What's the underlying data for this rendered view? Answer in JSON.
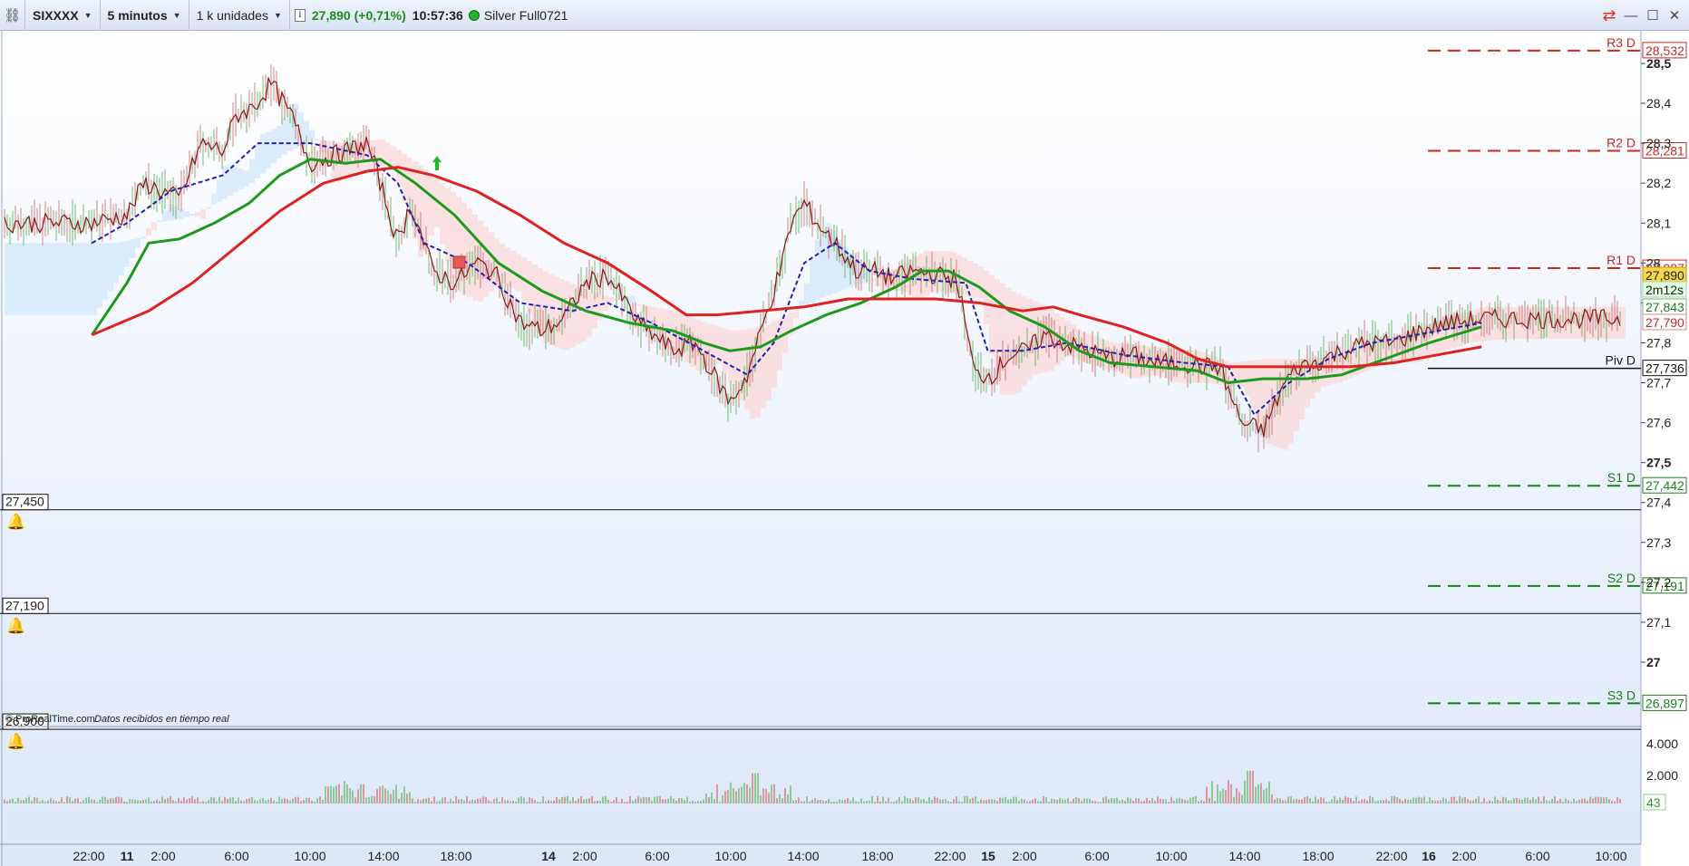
{
  "toolbar": {
    "symbol": "SIXXXX",
    "timeframe": "5 minutos",
    "units": "1 k unidades",
    "info_icon": "i",
    "quote": "27,890 (+0,71%)",
    "time": "10:57:36",
    "source": "Silver Full0721",
    "link_icon": "chain-link-icon",
    "status_color": "#22b22c"
  },
  "colors": {
    "sma_green": "#1d9a1d",
    "sma_red": "#dd2222",
    "price": "#8b1a1a",
    "kijun": "#1f22b0",
    "resistance": "#c62828",
    "support": "#1b7f1b"
  },
  "y_axis": {
    "ticks": [
      "28,5",
      "28,4",
      "28,3",
      "28,2",
      "28,1",
      "28",
      "27,9",
      "27,8",
      "27,7",
      "27,6",
      "27,5",
      "27,4",
      "27,3",
      "27,2",
      "27,1",
      "27"
    ],
    "bold_ticks": [
      "28,5",
      "27,5",
      "27"
    ]
  },
  "pivots": [
    {
      "name": "R3 D",
      "value": 28.532,
      "text": "28,532",
      "kind": "resistance"
    },
    {
      "name": "R2 D",
      "value": 28.281,
      "text": "28,281",
      "kind": "resistance"
    },
    {
      "name": "R1 D",
      "value": 27.987,
      "text": "27,987",
      "kind": "resistance"
    },
    {
      "name": "Piv D",
      "value": 27.736,
      "text": "27,736",
      "kind": "pivot"
    },
    {
      "name": "S1 D",
      "value": 27.442,
      "text": "27,442",
      "kind": "support"
    },
    {
      "name": "S2 D",
      "value": 27.191,
      "text": "27,191",
      "kind": "support"
    },
    {
      "name": "S3 D",
      "value": 26.897,
      "text": "26,897",
      "kind": "support"
    }
  ],
  "price_labels": [
    {
      "text": "27,890",
      "value": 27.89,
      "bg": "#f5d84a",
      "fg": "#222",
      "border": "#b89a10"
    },
    {
      "text": "2m12s",
      "value": 27.865,
      "bg": "#e2ffe2",
      "fg": "#222",
      "border": "#a9cfa9"
    },
    {
      "text": "27,843",
      "value": 27.843,
      "bg": "#ffffff",
      "fg": "#1b7f1b",
      "border": "#7ab07a"
    },
    {
      "text": "27,790",
      "value": 27.79,
      "bg": "#ffffff",
      "fg": "#c62828",
      "border": "#d58b8b"
    }
  ],
  "alerts": [
    {
      "text": "27,450",
      "value": 27.45,
      "icon": "bell-icon"
    },
    {
      "text": "27,190",
      "value": 27.19,
      "icon": "bell-icon"
    },
    {
      "text": "26,900",
      "value": 26.9,
      "icon": "bell-icon"
    }
  ],
  "markers": {
    "buy_arrow": {
      "day_x": 1.0,
      "price": 28.25,
      "icon": "up-arrow-icon"
    },
    "sell_square": {
      "day_x": 1.27,
      "price": 27.98,
      "icon": "square-marker-icon"
    }
  },
  "volume": {
    "ticks": [
      "4.000",
      "2.000"
    ],
    "current": "43",
    "max": 5000
  },
  "footer": {
    "copyright": "© ProRealTime.com",
    "realtime_text": "Datos recibidos en tiempo real"
  },
  "chart_data": {
    "type": "line",
    "title": "",
    "ylim": [
      26.9,
      28.6
    ],
    "x_axis_labels": [
      "22:00",
      "11",
      "2:00",
      "6:00",
      "10:00",
      "14:00",
      "18:00",
      "14",
      "2:00",
      "6:00",
      "10:00",
      "14:00",
      "18:00",
      "22:00",
      "15",
      "2:00",
      "6:00",
      "10:00",
      "14:00",
      "18:00",
      "22:00",
      "16",
      "2:00",
      "6:00",
      "10:00"
    ],
    "x_bold_labels": [
      "11",
      "14",
      "15",
      "16"
    ],
    "series": [
      {
        "name": "",
        "color_key": "price",
        "points": [
          [
            -0.08,
            28.1
          ],
          [
            0,
            28.12
          ],
          [
            0.04,
            28.2
          ],
          [
            0.08,
            28.18
          ],
          [
            0.12,
            28.16
          ],
          [
            0.17,
            28.3
          ],
          [
            0.22,
            28.28
          ],
          [
            0.25,
            28.37
          ],
          [
            0.29,
            28.39
          ],
          [
            0.33,
            28.45
          ],
          [
            0.38,
            28.36
          ],
          [
            0.42,
            28.25
          ],
          [
            0.5,
            28.28
          ],
          [
            0.55,
            28.3
          ],
          [
            0.58,
            28.2
          ],
          [
            0.62,
            28.05
          ],
          [
            0.65,
            28.15
          ],
          [
            0.7,
            27.98
          ],
          [
            0.75,
            27.95
          ],
          [
            0.8,
            28.0
          ],
          [
            0.84,
            27.98
          ],
          [
            0.9,
            27.85
          ],
          [
            0.95,
            27.83
          ],
          [
            1.0,
            27.86
          ],
          [
            1.05,
            27.95
          ],
          [
            1.1,
            27.97
          ],
          [
            1.17,
            27.85
          ],
          [
            1.25,
            27.78
          ],
          [
            1.3,
            27.8
          ],
          [
            1.38,
            27.65
          ],
          [
            1.42,
            27.72
          ],
          [
            1.5,
            28.0
          ],
          [
            1.52,
            28.1
          ],
          [
            1.55,
            28.15
          ],
          [
            1.58,
            28.1
          ],
          [
            1.62,
            28.05
          ],
          [
            1.67,
            27.98
          ],
          [
            1.72,
            27.98
          ],
          [
            1.75,
            27.96
          ],
          [
            1.8,
            27.98
          ],
          [
            1.85,
            27.97
          ],
          [
            1.9,
            27.96
          ],
          [
            1.94,
            27.72
          ],
          [
            1.98,
            27.72
          ],
          [
            2.02,
            27.77
          ],
          [
            2.06,
            27.78
          ],
          [
            2.1,
            27.82
          ],
          [
            2.14,
            27.8
          ],
          [
            2.2,
            27.78
          ],
          [
            2.25,
            27.76
          ],
          [
            2.3,
            27.77
          ],
          [
            2.35,
            27.75
          ],
          [
            2.42,
            27.75
          ],
          [
            2.46,
            27.74
          ],
          [
            2.5,
            27.74
          ],
          [
            2.55,
            27.6
          ],
          [
            2.6,
            27.58
          ],
          [
            2.65,
            27.7
          ],
          [
            2.68,
            27.74
          ],
          [
            2.72,
            27.75
          ],
          [
            2.78,
            27.78
          ],
          [
            2.84,
            27.8
          ],
          [
            2.9,
            27.8
          ],
          [
            2.96,
            27.83
          ],
          [
            3.02,
            27.85
          ],
          [
            3.1,
            27.86
          ]
        ],
        "noise": 0.025
      },
      {
        "name": "",
        "color_key": "kijun",
        "dashed": true,
        "points": [
          [
            -0.08,
            28.05
          ],
          [
            0,
            28.1
          ],
          [
            0.1,
            28.18
          ],
          [
            0.22,
            28.22
          ],
          [
            0.3,
            28.3
          ],
          [
            0.42,
            28.3
          ],
          [
            0.55,
            28.27
          ],
          [
            0.62,
            28.2
          ],
          [
            0.68,
            28.05
          ],
          [
            0.78,
            28.0
          ],
          [
            0.9,
            27.9
          ],
          [
            1.02,
            27.88
          ],
          [
            1.1,
            27.9
          ],
          [
            1.2,
            27.85
          ],
          [
            1.32,
            27.78
          ],
          [
            1.42,
            27.72
          ],
          [
            1.48,
            27.8
          ],
          [
            1.55,
            28.0
          ],
          [
            1.62,
            28.05
          ],
          [
            1.7,
            27.98
          ],
          [
            1.8,
            27.96
          ],
          [
            1.92,
            27.95
          ],
          [
            1.97,
            27.78
          ],
          [
            2.05,
            27.78
          ],
          [
            2.15,
            27.8
          ],
          [
            2.28,
            27.77
          ],
          [
            2.42,
            27.75
          ],
          [
            2.52,
            27.74
          ],
          [
            2.58,
            27.62
          ],
          [
            2.66,
            27.7
          ],
          [
            2.75,
            27.76
          ],
          [
            2.85,
            27.8
          ],
          [
            2.95,
            27.82
          ],
          [
            3.05,
            27.84
          ],
          [
            3.1,
            27.85
          ]
        ]
      },
      {
        "name": "",
        "color_key": "sma_green",
        "width": 3,
        "points": [
          [
            -0.08,
            27.82
          ],
          [
            0,
            27.95
          ],
          [
            0.05,
            28.05
          ],
          [
            0.12,
            28.06
          ],
          [
            0.2,
            28.1
          ],
          [
            0.28,
            28.15
          ],
          [
            0.35,
            28.22
          ],
          [
            0.42,
            28.26
          ],
          [
            0.5,
            28.25
          ],
          [
            0.58,
            28.26
          ],
          [
            0.66,
            28.2
          ],
          [
            0.75,
            28.12
          ],
          [
            0.85,
            28.0
          ],
          [
            0.95,
            27.93
          ],
          [
            1.05,
            27.88
          ],
          [
            1.15,
            27.85
          ],
          [
            1.25,
            27.83
          ],
          [
            1.32,
            27.8
          ],
          [
            1.38,
            27.78
          ],
          [
            1.45,
            27.79
          ],
          [
            1.52,
            27.83
          ],
          [
            1.6,
            27.87
          ],
          [
            1.68,
            27.9
          ],
          [
            1.76,
            27.94
          ],
          [
            1.82,
            27.98
          ],
          [
            1.88,
            27.98
          ],
          [
            1.95,
            27.94
          ],
          [
            2.02,
            27.88
          ],
          [
            2.1,
            27.84
          ],
          [
            2.18,
            27.78
          ],
          [
            2.25,
            27.75
          ],
          [
            2.35,
            27.74
          ],
          [
            2.45,
            27.73
          ],
          [
            2.52,
            27.7
          ],
          [
            2.6,
            27.71
          ],
          [
            2.7,
            27.71
          ],
          [
            2.78,
            27.72
          ],
          [
            2.88,
            27.76
          ],
          [
            2.98,
            27.8
          ],
          [
            3.1,
            27.84
          ]
        ]
      },
      {
        "name": "",
        "color_key": "sma_red",
        "width": 3,
        "points": [
          [
            -0.08,
            27.82
          ],
          [
            0.05,
            27.88
          ],
          [
            0.15,
            27.95
          ],
          [
            0.25,
            28.04
          ],
          [
            0.35,
            28.13
          ],
          [
            0.45,
            28.2
          ],
          [
            0.55,
            28.23
          ],
          [
            0.62,
            28.24
          ],
          [
            0.7,
            28.22
          ],
          [
            0.8,
            28.18
          ],
          [
            0.9,
            28.12
          ],
          [
            1.0,
            28.05
          ],
          [
            1.1,
            28.0
          ],
          [
            1.2,
            27.93
          ],
          [
            1.28,
            27.87
          ],
          [
            1.35,
            27.87
          ],
          [
            1.45,
            27.88
          ],
          [
            1.55,
            27.89
          ],
          [
            1.65,
            27.91
          ],
          [
            1.75,
            27.91
          ],
          [
            1.85,
            27.91
          ],
          [
            1.95,
            27.9
          ],
          [
            2.05,
            27.88
          ],
          [
            2.12,
            27.89
          ],
          [
            2.18,
            27.87
          ],
          [
            2.28,
            27.84
          ],
          [
            2.38,
            27.8
          ],
          [
            2.45,
            27.76
          ],
          [
            2.52,
            27.74
          ],
          [
            2.6,
            27.74
          ],
          [
            2.7,
            27.74
          ],
          [
            2.8,
            27.74
          ],
          [
            2.9,
            27.75
          ],
          [
            3.0,
            27.77
          ],
          [
            3.1,
            27.79
          ]
        ]
      }
    ]
  }
}
